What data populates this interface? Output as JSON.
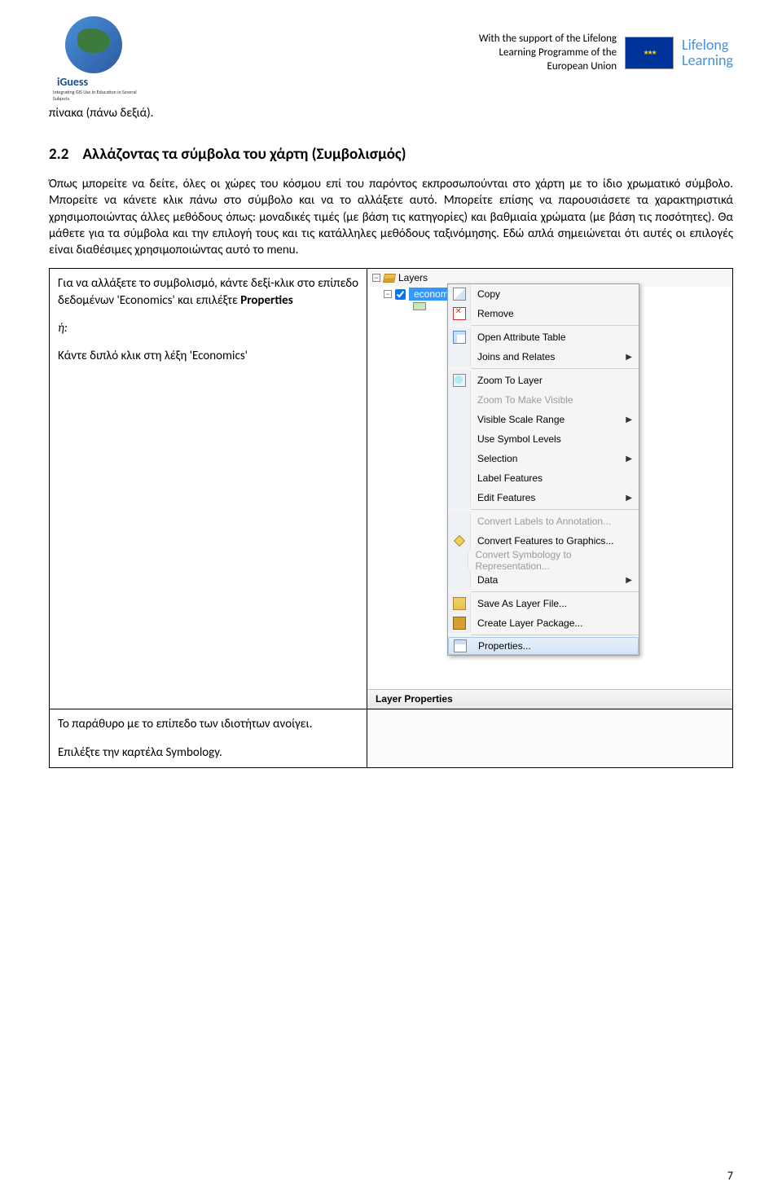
{
  "header": {
    "logo_brand": "iGuess",
    "logo_tagline": "Integrating GIS Use in Education in Several Subjects",
    "support_line1": "With the support of the Lifelong",
    "support_line2": "Learning Programme of the",
    "support_line3": "European Union",
    "lifelong1": "Lifelong",
    "lifelong2": "Learning"
  },
  "top_caption": "πίνακα (πάνω δεξιά).",
  "section": {
    "number": "2.2",
    "title": "Αλλάζοντας τα σύμβολα του χάρτη (Συμβολισμός)"
  },
  "para1": "Όπως μπορείτε να δείτε, όλες οι χώρες του κόσμου επί του παρόντος εκπροσωπούνται στο χάρτη με το ίδιο χρωματικό σύμβολο.  Μπορείτε να κάνετε κλικ πάνω στο σύμβολο και να το αλλάξετε αυτό.  Μπορείτε επίσης να παρουσιάσετε  τα χαρακτηριστικά χρησιμοποιώντας  άλλες μεθόδους όπως: μοναδικές τιμές (με βάση τις κατηγορίες) και βαθμιαία χρώματα (με βάση τις ποσότητες).  Θα μάθετε για τα σύμβολα και την  επιλογή τους και τις κατάλληλες μεθόδους ταξινόμησης.  Εδώ απλά σημειώνεται ότι αυτές οι επιλογές είναι διαθέσιμες χρησιμοποιώντας αυτό το menu.",
  "row1": {
    "pre": "Για να αλλάξετε το συμβολισμό, κάντε δεξί-κλικ στο επίπεδο δεδομένων 'Economics' και επιλέξτε ",
    "bold": "Properties",
    "or": "ή:",
    "alt": "Κάντε διπλό κλικ στη λέξη 'Economics'"
  },
  "row2": {
    "line1": "Το παράθυρο με το επίπεδο των  ιδιοτήτων ανοίγει.",
    "line2": "Επιλέξτε την καρτέλα Symbology."
  },
  "menu": {
    "toc_layers": "Layers",
    "toc_econom": "econom",
    "items": [
      {
        "label": "Copy",
        "icon": "ic-copy"
      },
      {
        "label": "Remove",
        "icon": "ic-remove"
      },
      {
        "sep": true
      },
      {
        "label": "Open Attribute Table",
        "icon": "ic-table"
      },
      {
        "label": "Joins and Relates",
        "sub": true
      },
      {
        "sep": true
      },
      {
        "label": "Zoom To Layer",
        "icon": "ic-zoom"
      },
      {
        "label": "Zoom To Make Visible",
        "disabled": true
      },
      {
        "label": "Visible Scale Range",
        "sub": true
      },
      {
        "label": "Use Symbol Levels"
      },
      {
        "label": "Selection",
        "sub": true
      },
      {
        "label": "Label Features"
      },
      {
        "label": "Edit Features",
        "sub": true
      },
      {
        "sep": true
      },
      {
        "label": "Convert Labels to Annotation...",
        "disabled": true
      },
      {
        "label": "Convert Features to Graphics...",
        "icon": "ic-diamond"
      },
      {
        "label": "Convert Symbology to Representation...",
        "disabled": true
      },
      {
        "label": "Data",
        "sub": true
      },
      {
        "sep": true
      },
      {
        "label": "Save As Layer File...",
        "icon": "ic-save"
      },
      {
        "label": "Create Layer Package...",
        "icon": "ic-pkg"
      },
      {
        "sep": true
      },
      {
        "label": "Properties...",
        "icon": "ic-props",
        "highlight": true
      }
    ],
    "status": "Layer Properties"
  },
  "page_number": "7"
}
